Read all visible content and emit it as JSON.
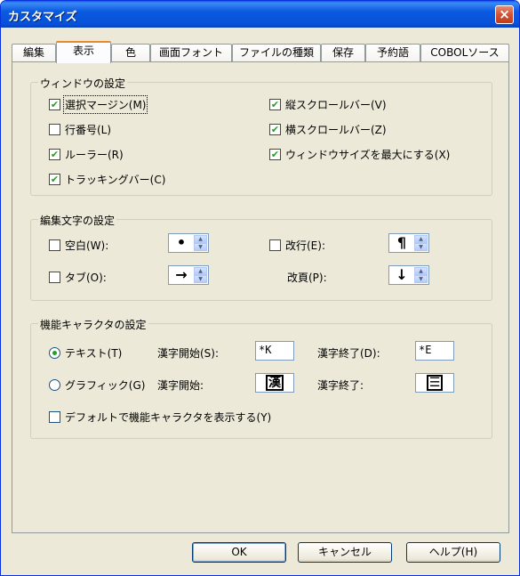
{
  "window": {
    "title": "カスタマイズ",
    "close_glyph": "×"
  },
  "tabs": [
    {
      "label": "編集"
    },
    {
      "label": "表示"
    },
    {
      "label": "色"
    },
    {
      "label": "画面フォント"
    },
    {
      "label": "ファイルの種類"
    },
    {
      "label": "保存"
    },
    {
      "label": "予約語"
    },
    {
      "label": "COBOLソース"
    }
  ],
  "active_tab": "表示",
  "window_settings": {
    "title": "ウィンドウの設定",
    "options": [
      {
        "label": "選択マージン(M)",
        "checked": true
      },
      {
        "label": "行番号(L)",
        "checked": false
      },
      {
        "label": "ルーラー(R)",
        "checked": true
      },
      {
        "label": "トラッキングバー(C)",
        "checked": true
      },
      {
        "label": "縦スクロールバー(V)",
        "checked": true
      },
      {
        "label": "横スクロールバー(Z)",
        "checked": true
      },
      {
        "label": "ウィンドウサイズを最大にする(X)",
        "checked": true
      }
    ]
  },
  "edit_chars": {
    "title": "編集文字の設定",
    "space": {
      "label": "空白(W):",
      "checked": false,
      "glyph": "•"
    },
    "tab": {
      "label": "タブ(O):",
      "checked": false,
      "glyph": "→"
    },
    "newline": {
      "label": "改行(E):",
      "checked": false,
      "glyph": "¶"
    },
    "pagebreak": {
      "label": "改頁(P):",
      "glyph": "↓"
    },
    "spin_up": "▲",
    "spin_down": "▼"
  },
  "func_chars": {
    "title": "機能キャラクタの設定",
    "text_radio": {
      "label": "テキスト(T)",
      "selected": true
    },
    "graphic_radio": {
      "label": "グラフィック(G)",
      "selected": false
    },
    "kanji_start_s": "漢字開始(S):",
    "kanji_start_value": "*K",
    "kanji_end_d": "漢字終了(D):",
    "kanji_end_value": "*E",
    "kanji_start": "漢字開始:",
    "kanji_start_glyph": "漢",
    "kanji_end": "漢字終了:",
    "kanji_end_glyph": "☰",
    "default_display": {
      "label": "デフォルトで機能キャラクタを表示する(Y)",
      "checked": false
    }
  },
  "buttons": {
    "ok": "OK",
    "cancel": "キャンセル",
    "help": "ヘルプ(H)"
  },
  "colors": {
    "titlebar": "#0a5ae0",
    "dialog_bg": "#ece9d8",
    "check_mark": "#21a121",
    "active_tab_accent": "#e68b2c"
  }
}
